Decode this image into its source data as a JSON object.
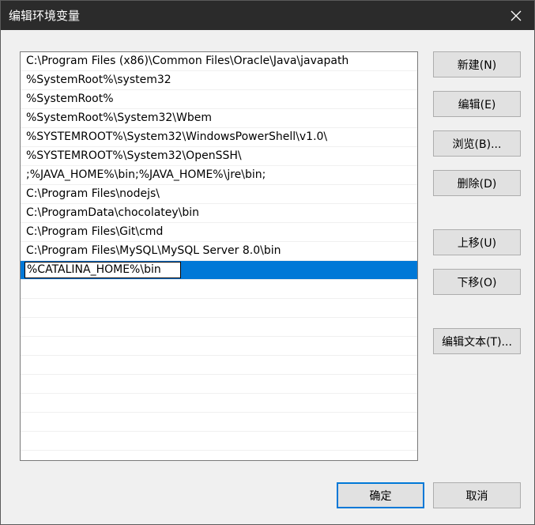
{
  "window": {
    "title": "编辑环境变量",
    "close_icon": "close-icon"
  },
  "list": {
    "items": [
      "C:\\Program Files (x86)\\Common Files\\Oracle\\Java\\javapath",
      "%SystemRoot%\\system32",
      "%SystemRoot%",
      "%SystemRoot%\\System32\\Wbem",
      "%SYSTEMROOT%\\System32\\WindowsPowerShell\\v1.0\\",
      "%SYSTEMROOT%\\System32\\OpenSSH\\",
      ";%JAVA_HOME%\\bin;%JAVA_HOME%\\jre\\bin;",
      "C:\\Program Files\\nodejs\\",
      "C:\\ProgramData\\chocolatey\\bin",
      "C:\\Program Files\\Git\\cmd",
      "C:\\Program Files\\MySQL\\MySQL Server 8.0\\bin"
    ],
    "editing_value": "%CATALINA_HOME%\\bin",
    "selection_color": "#0078d7"
  },
  "buttons": {
    "new": "新建(N)",
    "edit": "编辑(E)",
    "browse": "浏览(B)...",
    "delete": "删除(D)",
    "move_up": "上移(U)",
    "move_down": "下移(O)",
    "edit_text": "编辑文本(T)...",
    "ok": "确定",
    "cancel": "取消"
  }
}
